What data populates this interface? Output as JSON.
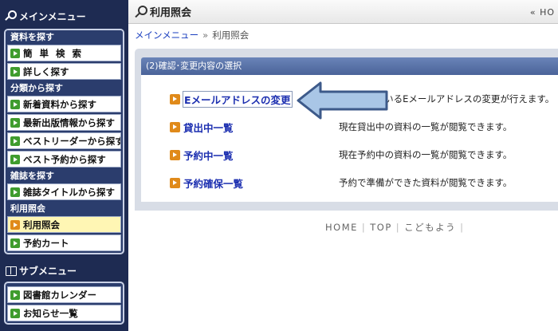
{
  "sidebar": {
    "main_menu_title": "メインメニュー",
    "main_sections": [
      {
        "category": "資料を探す",
        "items": [
          {
            "label": "簡単検索",
            "spaced": true
          },
          {
            "label": "詳しく探す"
          }
        ]
      },
      {
        "category": "分類から探す",
        "items": [
          {
            "label": "新着資料から探す"
          },
          {
            "label": "最新出版情報から探す"
          },
          {
            "label": "ベストリーダーから探す"
          },
          {
            "label": "ベスト予約から探す"
          }
        ]
      },
      {
        "category": "雑誌を探す",
        "items": [
          {
            "label": "雑誌タイトルから探す"
          }
        ]
      },
      {
        "category": "利用照会",
        "items": [
          {
            "label": "利用照会",
            "active": true
          },
          {
            "label": "予約カート"
          }
        ]
      }
    ],
    "sub_menu_title": "サブメニュー",
    "sub_items": [
      {
        "label": "図書館カレンダー"
      },
      {
        "label": "お知らせ一覧"
      }
    ]
  },
  "header": {
    "title": "利用照会",
    "home_link": "« HO"
  },
  "breadcrumb": {
    "root": "メインメニュー",
    "separator": "»",
    "current": "利用照会"
  },
  "panel": {
    "heading": "(2)確認･変更内容の選択",
    "rows": [
      {
        "link": "Eメールアドレスの変更",
        "desc": "登録されているEメールアドレスの変更が行えます。",
        "selected": true
      },
      {
        "link": "貸出中一覧",
        "desc": "現在貸出中の資料の一覧が閲覧できます。"
      },
      {
        "link": "予約中一覧",
        "desc": "現在予約中の資料の一覧が閲覧できます。"
      },
      {
        "link": "予約確保一覧",
        "desc": "予約で準備ができた資料が閲覧できます。"
      }
    ]
  },
  "footer": {
    "home": "HOME",
    "top": "TOP",
    "kids": "こどもよう",
    "separator": "|"
  },
  "colors": {
    "sidebar_bg": "#1e2b52",
    "menu_arrow_green": "#3f9c2e",
    "row_arrow_orange": "#e08a1a",
    "link_blue": "#1c2fb0",
    "panel_head": "#5a73a8",
    "active_item_bg": "#fff6b4",
    "pointer_arrow": "#a9c6e6"
  },
  "icons": {
    "menu": "magnifier-icon",
    "sub_menu": "book-icon",
    "pointer": "left-arrow-icon"
  }
}
